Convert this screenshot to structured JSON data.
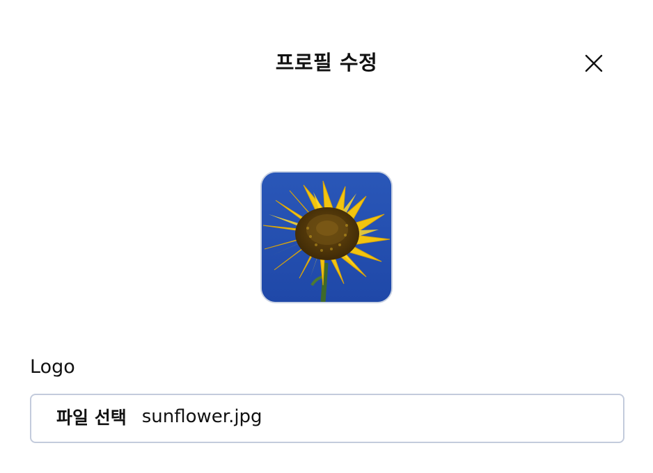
{
  "dialog": {
    "title": "프로필 수정",
    "close_icon": "close-icon"
  },
  "avatar": {
    "image_subject": "sunflower",
    "sky_color": "#2350b2",
    "petal_color": "#f2c40f",
    "center_color": "#5a3a0a"
  },
  "logo_field": {
    "label": "Logo",
    "button_label": "파일 선택",
    "file_name": "sunflower.jpg"
  }
}
